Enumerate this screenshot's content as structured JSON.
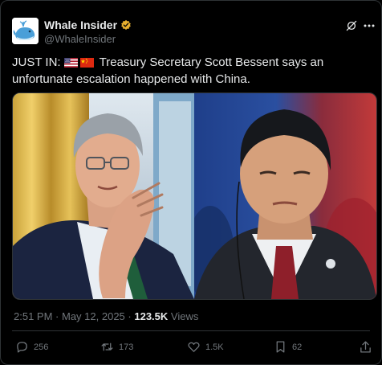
{
  "author": {
    "display_name": "Whale Insider",
    "handle": "@WhaleInsider"
  },
  "tweet": {
    "prefix": "JUST IN:",
    "body": "Treasury Secretary Scott Bessent says an unfortunate escalation happened with China."
  },
  "meta": {
    "time": "2:51 PM",
    "date": "May 12, 2025",
    "views_count": "123.5K",
    "views_label": "Views"
  },
  "actions": {
    "replies": "256",
    "reposts": "173",
    "likes": "1.5K",
    "bookmarks": "62"
  },
  "colors": {
    "background": "#000000",
    "text": "#e7e9ea",
    "secondary": "#71767b",
    "border": "#2f3336",
    "verified_gold": "#e8b02e"
  },
  "icons": [
    "whale-avatar-icon",
    "verified-badge-icon",
    "grok-icon",
    "more-icon",
    "us-flag-icon",
    "china-flag-icon",
    "reply-icon",
    "repost-icon",
    "like-icon",
    "bookmark-icon",
    "share-icon"
  ]
}
